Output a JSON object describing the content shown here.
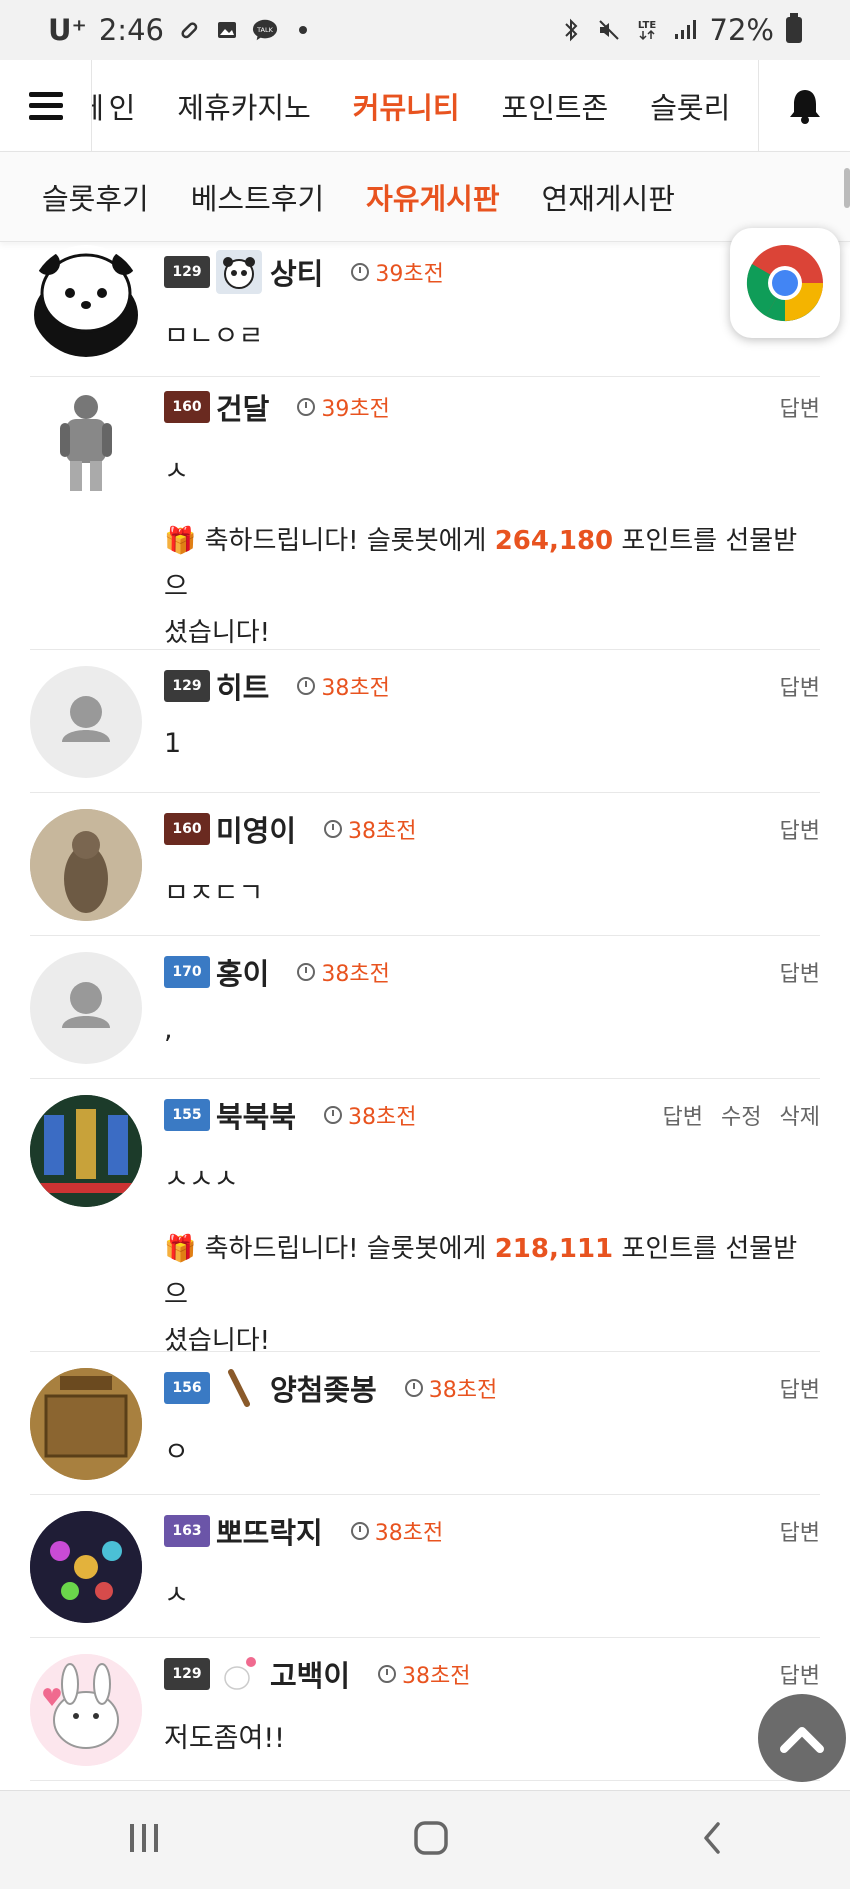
{
  "status_bar": {
    "carrier": "U⁺",
    "time": "2:46",
    "left_icons": [
      "pill-icon",
      "gallery-icon",
      "talk-icon",
      "dot-icon"
    ],
    "talk_label": "TALK",
    "right_icons": [
      "bluetooth-icon",
      "mute-icon",
      "lte-icon",
      "signal-icon"
    ],
    "network": "LTE",
    "battery": "72%"
  },
  "main_nav": {
    "items": [
      {
        "label": "메인",
        "shown": "ㅔ인"
      },
      {
        "label": "제휴카지노"
      },
      {
        "label": "커뮤니티",
        "active": true
      },
      {
        "label": "포인트존"
      },
      {
        "label": "슬롯리"
      }
    ]
  },
  "sub_nav": {
    "items": [
      {
        "label": "슬롯후기"
      },
      {
        "label": "베스트후기"
      },
      {
        "label": "자유게시판",
        "active": true
      },
      {
        "label": "연재게시판"
      }
    ]
  },
  "comments": [
    {
      "level": "129",
      "nick": "상티",
      "time": "39초전",
      "text": "ㅁㄴㅇㄹ",
      "actions": []
    },
    {
      "level": "160",
      "nick": "건달",
      "time": "39초전",
      "text": "ㅅ",
      "actions": [
        "답변"
      ],
      "gift": {
        "prefix": "축하드립니다! 슬롯봇에게 ",
        "points": "264,180",
        "suffix_line1": " 포인트를 선물받으",
        "suffix_line2": "셨습니다!"
      }
    },
    {
      "level": "129",
      "nick": "히트",
      "time": "38초전",
      "text": "1",
      "actions": [
        "답변"
      ]
    },
    {
      "level": "160",
      "nick": "미영이",
      "time": "38초전",
      "text": "ㅁㅈㄷㄱ",
      "actions": [
        "답변"
      ]
    },
    {
      "level": "170",
      "nick": "홍이",
      "time": "38초전",
      "text": ",",
      "actions": [
        "답변"
      ]
    },
    {
      "level": "155",
      "nick": "북북북",
      "time": "38초전",
      "text": "ㅅㅅㅅ",
      "actions": [
        "답변",
        "수정",
        "삭제"
      ],
      "gift": {
        "prefix": "축하드립니다! 슬롯봇에게 ",
        "points": "218,111",
        "suffix_line1": " 포인트를 선물받으",
        "suffix_line2": "셨습니다!"
      }
    },
    {
      "level": "156",
      "nick": "양첨좆봉",
      "time": "38초전",
      "text": "ㅇ",
      "actions": [
        "답변"
      ]
    },
    {
      "level": "163",
      "nick": "뽀뜨락지",
      "time": "38초전",
      "text": "ㅅ",
      "actions": [
        "답변"
      ]
    },
    {
      "level": "129",
      "nick": "고백이",
      "time": "38초전",
      "text": "저도좀여!!",
      "actions": [
        "답변"
      ]
    }
  ],
  "colors": {
    "accent": "#e8531f",
    "text": "#222222",
    "muted": "#666666"
  },
  "floating": {
    "chrome_icon": "chrome-icon",
    "to_top_icon": "chevron-up-icon"
  },
  "android_nav": [
    "recents-icon",
    "home-icon",
    "back-icon"
  ]
}
